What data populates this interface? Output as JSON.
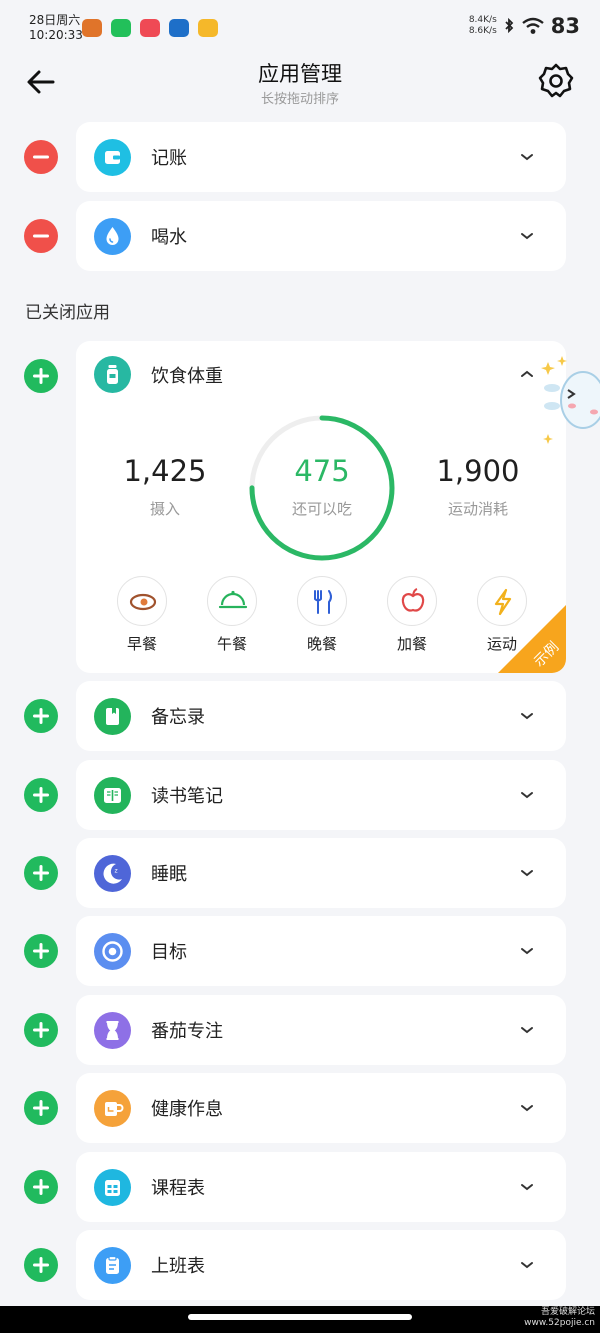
{
  "status_bar": {
    "date": "28日周六",
    "time": "10:20:33",
    "net_up": "8.4K/s",
    "net_down": "8.6K/s",
    "battery": "83",
    "notif_icons": [
      "cat-app-icon",
      "wechat-icon",
      "red-app-icon",
      "blue-app-icon",
      "yellow-app-icon"
    ]
  },
  "header": {
    "title": "应用管理",
    "subtitle": "长按拖动排序"
  },
  "enabled_apps": [
    {
      "name": "记账",
      "icon": "wallet-icon",
      "color": "#1fbfe3"
    },
    {
      "name": "喝水",
      "icon": "water-drop-icon",
      "color": "#3d9ef5"
    }
  ],
  "section_label": "已关闭应用",
  "expanded_app": {
    "name": "饮食体重",
    "icon": "bottle-icon",
    "color": "#27b8a2",
    "intake_value": "1,425",
    "intake_label": "摄入",
    "remaining_value": "475",
    "remaining_label": "还可以吃",
    "burn_value": "1,900",
    "burn_label": "运动消耗",
    "ring_progress": 0.75,
    "meals": [
      {
        "label": "早餐",
        "icon": "breakfast-icon"
      },
      {
        "label": "午餐",
        "icon": "lunch-cloche-icon"
      },
      {
        "label": "晚餐",
        "icon": "dinner-utensils-icon"
      },
      {
        "label": "加餐",
        "icon": "apple-icon"
      },
      {
        "label": "运动",
        "icon": "lightning-icon"
      }
    ],
    "sample_badge": "示例"
  },
  "disabled_apps": [
    {
      "name": "备忘录",
      "icon": "notebook-icon",
      "color": "#23b45c"
    },
    {
      "name": "读书笔记",
      "icon": "book-icon",
      "color": "#23b45c"
    },
    {
      "name": "睡眠",
      "icon": "moon-icon",
      "color": "#4f66d8"
    },
    {
      "name": "目标",
      "icon": "target-icon",
      "color": "#5b8ef0"
    },
    {
      "name": "番茄专注",
      "icon": "hourglass-icon",
      "color": "#8e70e6"
    },
    {
      "name": "健康作息",
      "icon": "cup-icon",
      "color": "#f5a23a"
    },
    {
      "name": "课程表",
      "icon": "calendar-grid-icon",
      "color": "#1fb7e0"
    },
    {
      "name": "上班表",
      "icon": "clipboard-icon",
      "color": "#3d9ef5"
    }
  ],
  "watermark": {
    "line1": "吾爱破解论坛",
    "line2": "www.52pojie.cn"
  }
}
